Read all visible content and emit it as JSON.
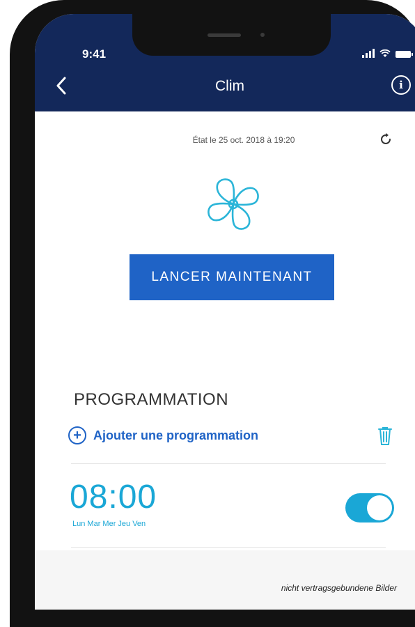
{
  "status_bar": {
    "time": "9:41"
  },
  "nav": {
    "title": "Clim",
    "info_label": "i"
  },
  "state": {
    "text": "État le 25 oct. 2018 à 19:20"
  },
  "launch_button": {
    "label": "LANCER MAINTENANT"
  },
  "programmation": {
    "title": "PROGRAMMATION",
    "add_label": "Ajouter une programmation",
    "entries": [
      {
        "time": "08:00",
        "days": "Lun Mar Mer Jeu Ven",
        "enabled": true
      }
    ]
  },
  "disclaimer": "nicht vertragsgebundene Bilder",
  "colors": {
    "header": "#13285a",
    "accent": "#1f63c6",
    "teal": "#1aa7d6"
  },
  "icons": [
    "back-icon",
    "info-icon",
    "refresh-icon",
    "fan-icon",
    "plus-icon",
    "trash-icon"
  ]
}
